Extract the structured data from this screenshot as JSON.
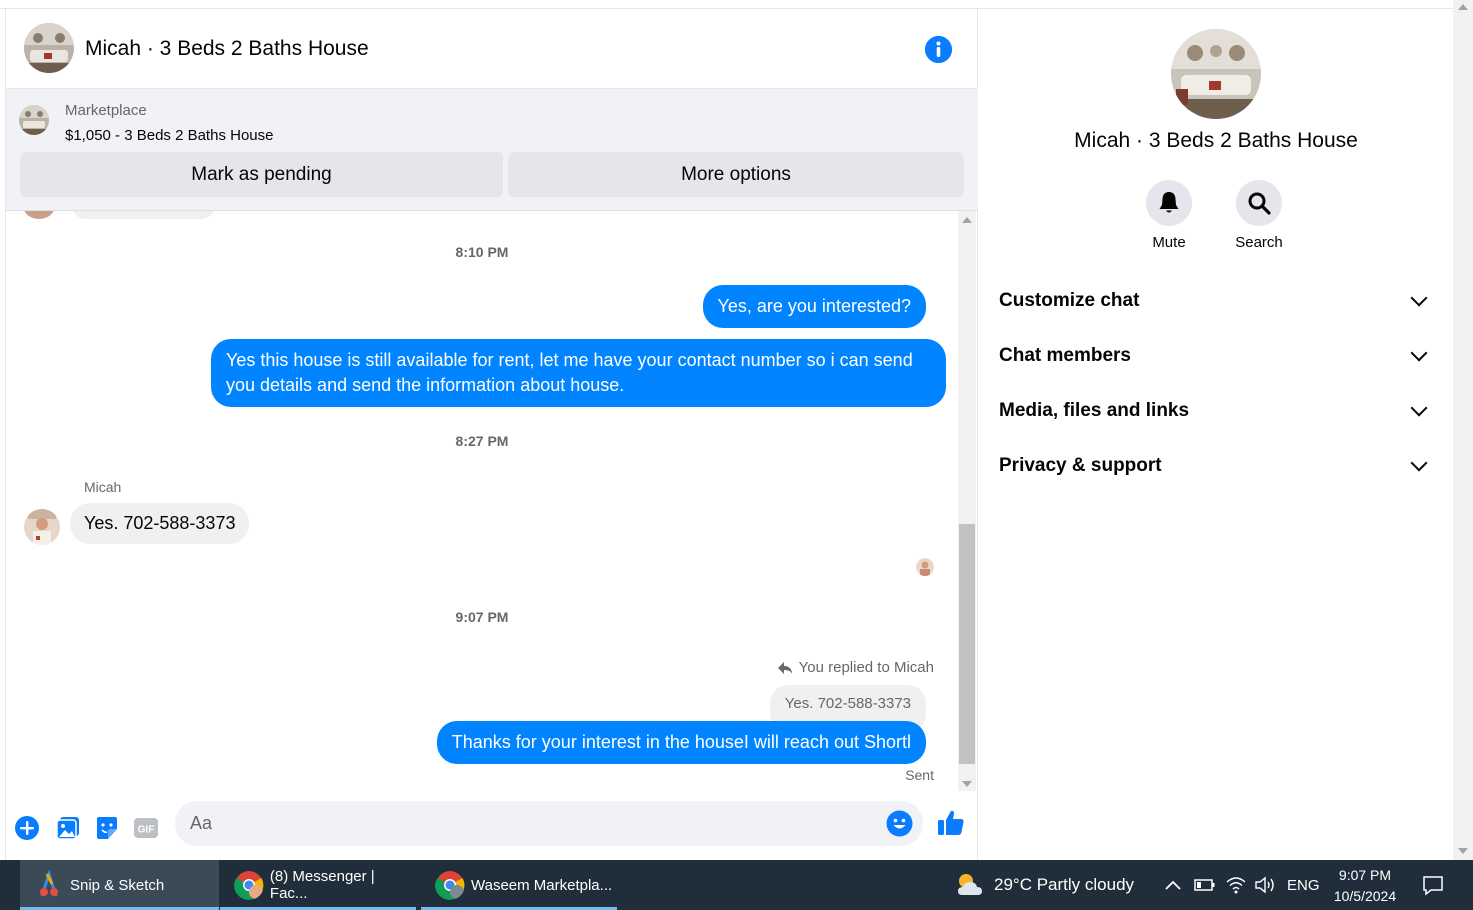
{
  "header": {
    "title": "Micah · 3 Beds 2 Baths House"
  },
  "marketplace": {
    "label": "Marketplace",
    "listing": "$1,050 - 3 Beds 2 Baths House",
    "mark_pending_label": "Mark as pending",
    "more_options_label": "More options"
  },
  "messages": {
    "ts1": "8:10 PM",
    "out1": "Yes, are you interested?",
    "out2": "Yes this house is still available for rent, let me have your contact number so i can send you details and send the information about house.",
    "ts2": "8:27 PM",
    "sender_name": "Micah",
    "in1": "Yes. 702-588-3373",
    "ts3": "9:07 PM",
    "reply_note": "You replied to Micah",
    "quoted": "Yes. 702-588-3373",
    "out3": "Thanks for your interest in the houseI will reach out Shortl",
    "status": "Sent"
  },
  "composer": {
    "placeholder": "Aa",
    "gif_label": "GIF"
  },
  "side": {
    "title": "Micah · 3 Beds 2 Baths House",
    "mute_label": "Mute",
    "search_label": "Search",
    "sections": [
      "Customize chat",
      "Chat members",
      "Media, files and links",
      "Privacy & support"
    ]
  },
  "taskbar": {
    "apps": [
      "Snip & Sketch",
      "(8) Messenger | Fac...",
      "Waseem Marketpla..."
    ],
    "weather": "29°C  Partly cloudy",
    "lang": "ENG",
    "time": "9:07 PM",
    "date": "10/5/2024"
  },
  "colors": {
    "accent": "#0084ff",
    "info": "#0a7cff",
    "taskbar": "#1f2e3a"
  }
}
